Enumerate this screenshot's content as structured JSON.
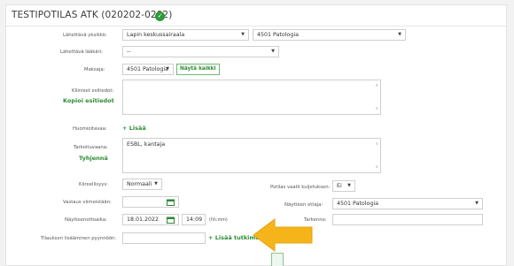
{
  "header": {
    "title": "TESTIPOTILAS ATK (020202-0202)",
    "status_icon": "check-icon",
    "status_color": "#2f9a3a"
  },
  "fields": {
    "sending_unit": {
      "label": "Lähettävä yksikkö:",
      "value1": "Lapin keskussairaala",
      "value2": "4501 Patologia"
    },
    "sending_doctor": {
      "label": "Lähettävä lääkäri:",
      "value": "--"
    },
    "payer": {
      "label": "Maksaja:",
      "value": "4501 Patologia",
      "show_all": "Näytä kaikki"
    },
    "clinical_info": {
      "label": "Kliiniset esitiedot:",
      "copy_link": "Kopioi esitiedot"
    },
    "notes": {
      "label": "Huomioitavaa:",
      "add_link": "+ Lisää"
    },
    "indication": {
      "label": "Tarkoituvaana:",
      "value": "ESBL, kantaja",
      "clear_link": "Tyhjennä"
    },
    "urgency": {
      "label": "Kiireellisyys:",
      "value": "Normaali"
    },
    "transport": {
      "label": "Potilas vaatii kuljetuksen:",
      "value": "Ei"
    },
    "reply_by": {
      "label": "Vastaus viimeistään:"
    },
    "sample_taker": {
      "label": "Näytteen ottaja:",
      "value": "4501 Patologia"
    },
    "sample_date": {
      "label": "Näytteenottoaika:",
      "date": "18.01.2022",
      "time": "14:09",
      "time_hint": "(hh:mm)"
    },
    "specifier": {
      "label": "Tarkenne:"
    },
    "order_code": {
      "label": "Tilauksen lisääminen pyynnöön:",
      "add_study": "+ Lisää tutkimus"
    }
  },
  "colors": {
    "accent_green": "#2d8a34",
    "arrow": "#f5b419"
  }
}
